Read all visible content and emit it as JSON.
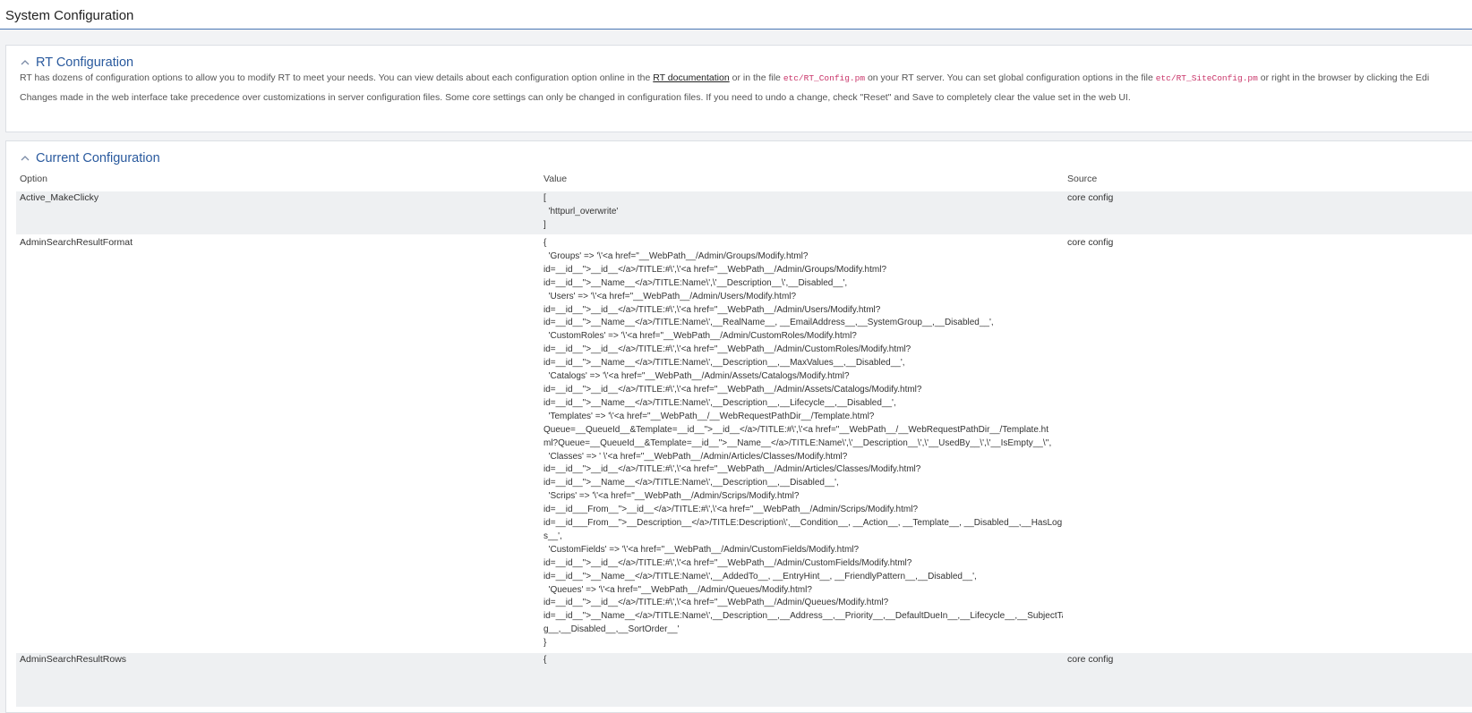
{
  "header": {
    "title": "System Configuration"
  },
  "rt_panel": {
    "title": "RT Configuration",
    "line1_a": "RT has dozens of configuration options to allow you to modify RT to meet your needs. You can view details about each configuration option online in the ",
    "doc_link": "RT documentation",
    "line1_b": " or in the file ",
    "path1": "etc/RT_Config.pm",
    "line1_c": " on your RT server. You can set global configuration options in the file ",
    "path2": "etc/RT_SiteConfig.pm",
    "line1_d": " or right in the browser by clicking the Edi",
    "line2": "Changes made in the web interface take precedence over customizations in server configuration files. Some core settings can only be changed in configuration files. If you need to undo a change, check \"Reset\" and Save to completely clear the value set in the web UI."
  },
  "current_panel": {
    "title": "Current Configuration",
    "columns": {
      "option": "Option",
      "value": "Value",
      "source": "Source"
    },
    "rows": [
      {
        "option": "Active_MakeClicky",
        "value": "[\n  'httpurl_overwrite'\n]",
        "source": "core config"
      },
      {
        "option": "AdminSearchResultFormat",
        "value": "{\n  'Groups' => '\\'<a href=\"__WebPath__/Admin/Groups/Modify.html?\nid=__id__\">__id__</a>/TITLE:#\\',\\'<a href=\"__WebPath__/Admin/Groups/Modify.html?\nid=__id__\">__Name__</a>/TITLE:Name\\',\\'__Description__\\',__Disabled__',\n  'Users' => '\\'<a href=\"__WebPath__/Admin/Users/Modify.html?\nid=__id__\">__id__</a>/TITLE:#\\',\\'<a href=\"__WebPath__/Admin/Users/Modify.html?\nid=__id__\">__Name__</a>/TITLE:Name\\',__RealName__, __EmailAddress__,__SystemGroup__,__Disabled__',\n  'CustomRoles' => '\\'<a href=\"__WebPath__/Admin/CustomRoles/Modify.html?\nid=__id__\">__id__</a>/TITLE:#\\',\\'<a href=\"__WebPath__/Admin/CustomRoles/Modify.html?\nid=__id__\">__Name__</a>/TITLE:Name\\',__Description__,__MaxValues__,__Disabled__',\n  'Catalogs' => '\\'<a href=\"__WebPath__/Admin/Assets/Catalogs/Modify.html?\nid=__id__\">__id__</a>/TITLE:#\\',\\'<a href=\"__WebPath__/Admin/Assets/Catalogs/Modify.html?\nid=__id__\">__Name__</a>/TITLE:Name\\',__Description__,__Lifecycle__,__Disabled__',\n  'Templates' => '\\'<a href=\"__WebPath__/__WebRequestPathDir__/Template.html?\nQueue=__QueueId__&Template=__id__\">__id__</a>/TITLE:#\\',\\'<a href=\"__WebPath__/__WebRequestPathDir__/Template.ht\nml?Queue=__QueueId__&Template=__id__\">__Name__</a>/TITLE:Name\\',\\'__Description__\\',\\'__UsedBy__\\',\\'__IsEmpty__\\'',\n  'Classes' => ' \\'<a href=\"__WebPath__/Admin/Articles/Classes/Modify.html?\nid=__id__\">__id__</a>/TITLE:#\\',\\'<a href=\"__WebPath__/Admin/Articles/Classes/Modify.html?\nid=__id__\">__Name__</a>/TITLE:Name\\',__Description__,__Disabled__',\n  'Scrips' => '\\'<a href=\"__WebPath__/Admin/Scrips/Modify.html?\nid=__id___From__\">__id__</a>/TITLE:#\\',\\'<a href=\"__WebPath__/Admin/Scrips/Modify.html?\nid=__id___From__\">__Description__</a>/TITLE:Description\\',__Condition__, __Action__, __Template__, __Disabled__,__HasLog\ns__',\n  'CustomFields' => '\\'<a href=\"__WebPath__/Admin/CustomFields/Modify.html?\nid=__id__\">__id__</a>/TITLE:#\\',\\'<a href=\"__WebPath__/Admin/CustomFields/Modify.html?\nid=__id__\">__Name__</a>/TITLE:Name\\',__AddedTo__, __EntryHint__, __FriendlyPattern__,__Disabled__',\n  'Queues' => '\\'<a href=\"__WebPath__/Admin/Queues/Modify.html?\nid=__id__\">__id__</a>/TITLE:#\\',\\'<a href=\"__WebPath__/Admin/Queues/Modify.html?\nid=__id__\">__Name__</a>/TITLE:Name\\',__Description__,__Address__,__Priority__,__DefaultDueIn__,__Lifecycle__,__SubjectTa\ng__,__Disabled__,__SortOrder__'\n}",
        "source": "core config"
      },
      {
        "option": "AdminSearchResultRows",
        "value": "{",
        "source": "core config"
      }
    ]
  }
}
